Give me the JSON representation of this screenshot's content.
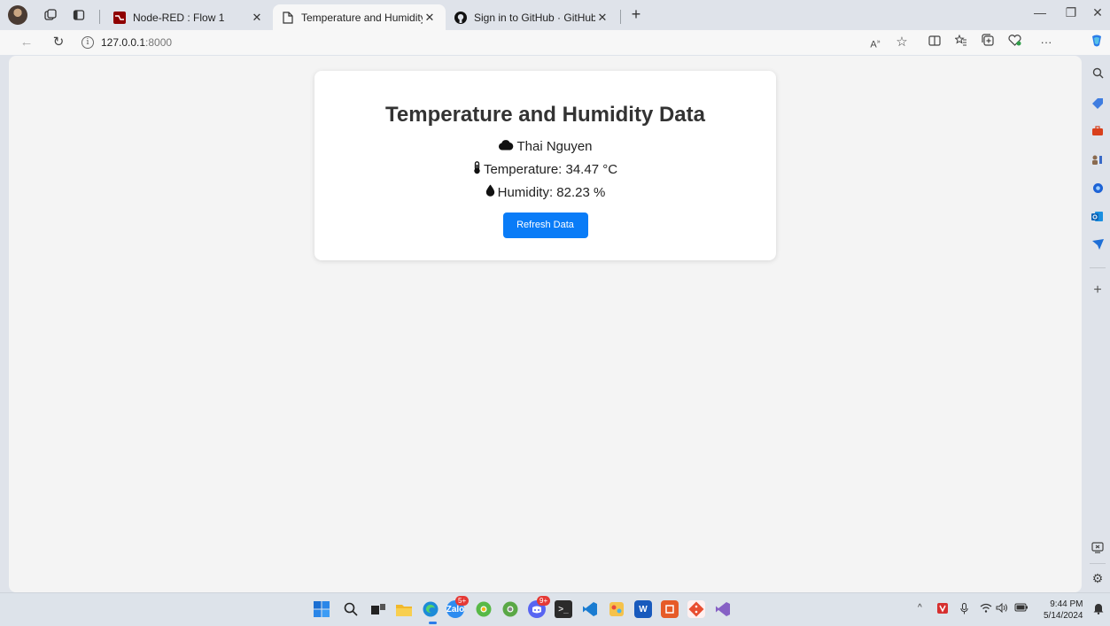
{
  "browser": {
    "tabs": [
      {
        "title": "Node-RED : Flow 1",
        "favicon": "node-red-icon",
        "active": false
      },
      {
        "title": "Temperature and Humidity Data",
        "favicon": "page-icon",
        "active": true
      },
      {
        "title": "Sign in to GitHub · GitHub",
        "favicon": "github-icon",
        "active": false
      }
    ],
    "url": {
      "host": "127.0.0.1",
      "port": ":8000"
    }
  },
  "page": {
    "title": "Temperature and Humidity Data",
    "location": "Thai Nguyen",
    "temperature": "Temperature: 34.47 °C",
    "humidity": "Humidity: 82.23 %",
    "refresh_label": "Refresh Data"
  },
  "taskbar": {
    "time": "9:44 PM",
    "date": "5/14/2024",
    "badges": {
      "zalo": "5+",
      "discord": "9+"
    }
  },
  "colors": {
    "accent": "#0a7cf7",
    "page_bg": "#f4f4f4",
    "card_bg": "#ffffff",
    "chrome_bg": "#dfe3ea"
  }
}
